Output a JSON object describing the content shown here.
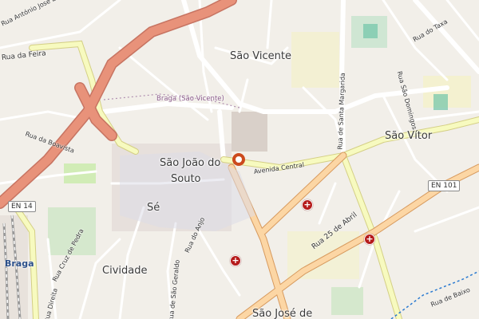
{
  "map": {
    "districts": [
      "São Vicente",
      "São Vítor",
      "São João do",
      "Souto",
      "Sé",
      "Cividade",
      "São José de"
    ],
    "streets": [
      "Rua da Boavista",
      "Avenida Central",
      "Rua de Santa Margarida",
      "Rua 25 de Abril",
      "Rua do Taxa",
      "Rua São Domingos",
      "Rua do Anjo",
      "Rua Cruz de Pedra",
      "Rua Direita",
      "Rua de São Geraldo",
      "Rua de Baixo",
      "Rua da Feira",
      "Rua António José Lo"
    ],
    "area_label": "Braga (São Vicente)",
    "city": "Braga",
    "road_shields": [
      "EN 14",
      "EN 101"
    ],
    "hospital_symbol": "+",
    "colors": {
      "background": "#f2efe9",
      "motorway": "#e8927a",
      "primary": "#fcd6a4",
      "secondary": "#f7fabf",
      "rail": "#999999",
      "marker": "#cc4a1d",
      "hospital": "#b51b1b"
    }
  }
}
